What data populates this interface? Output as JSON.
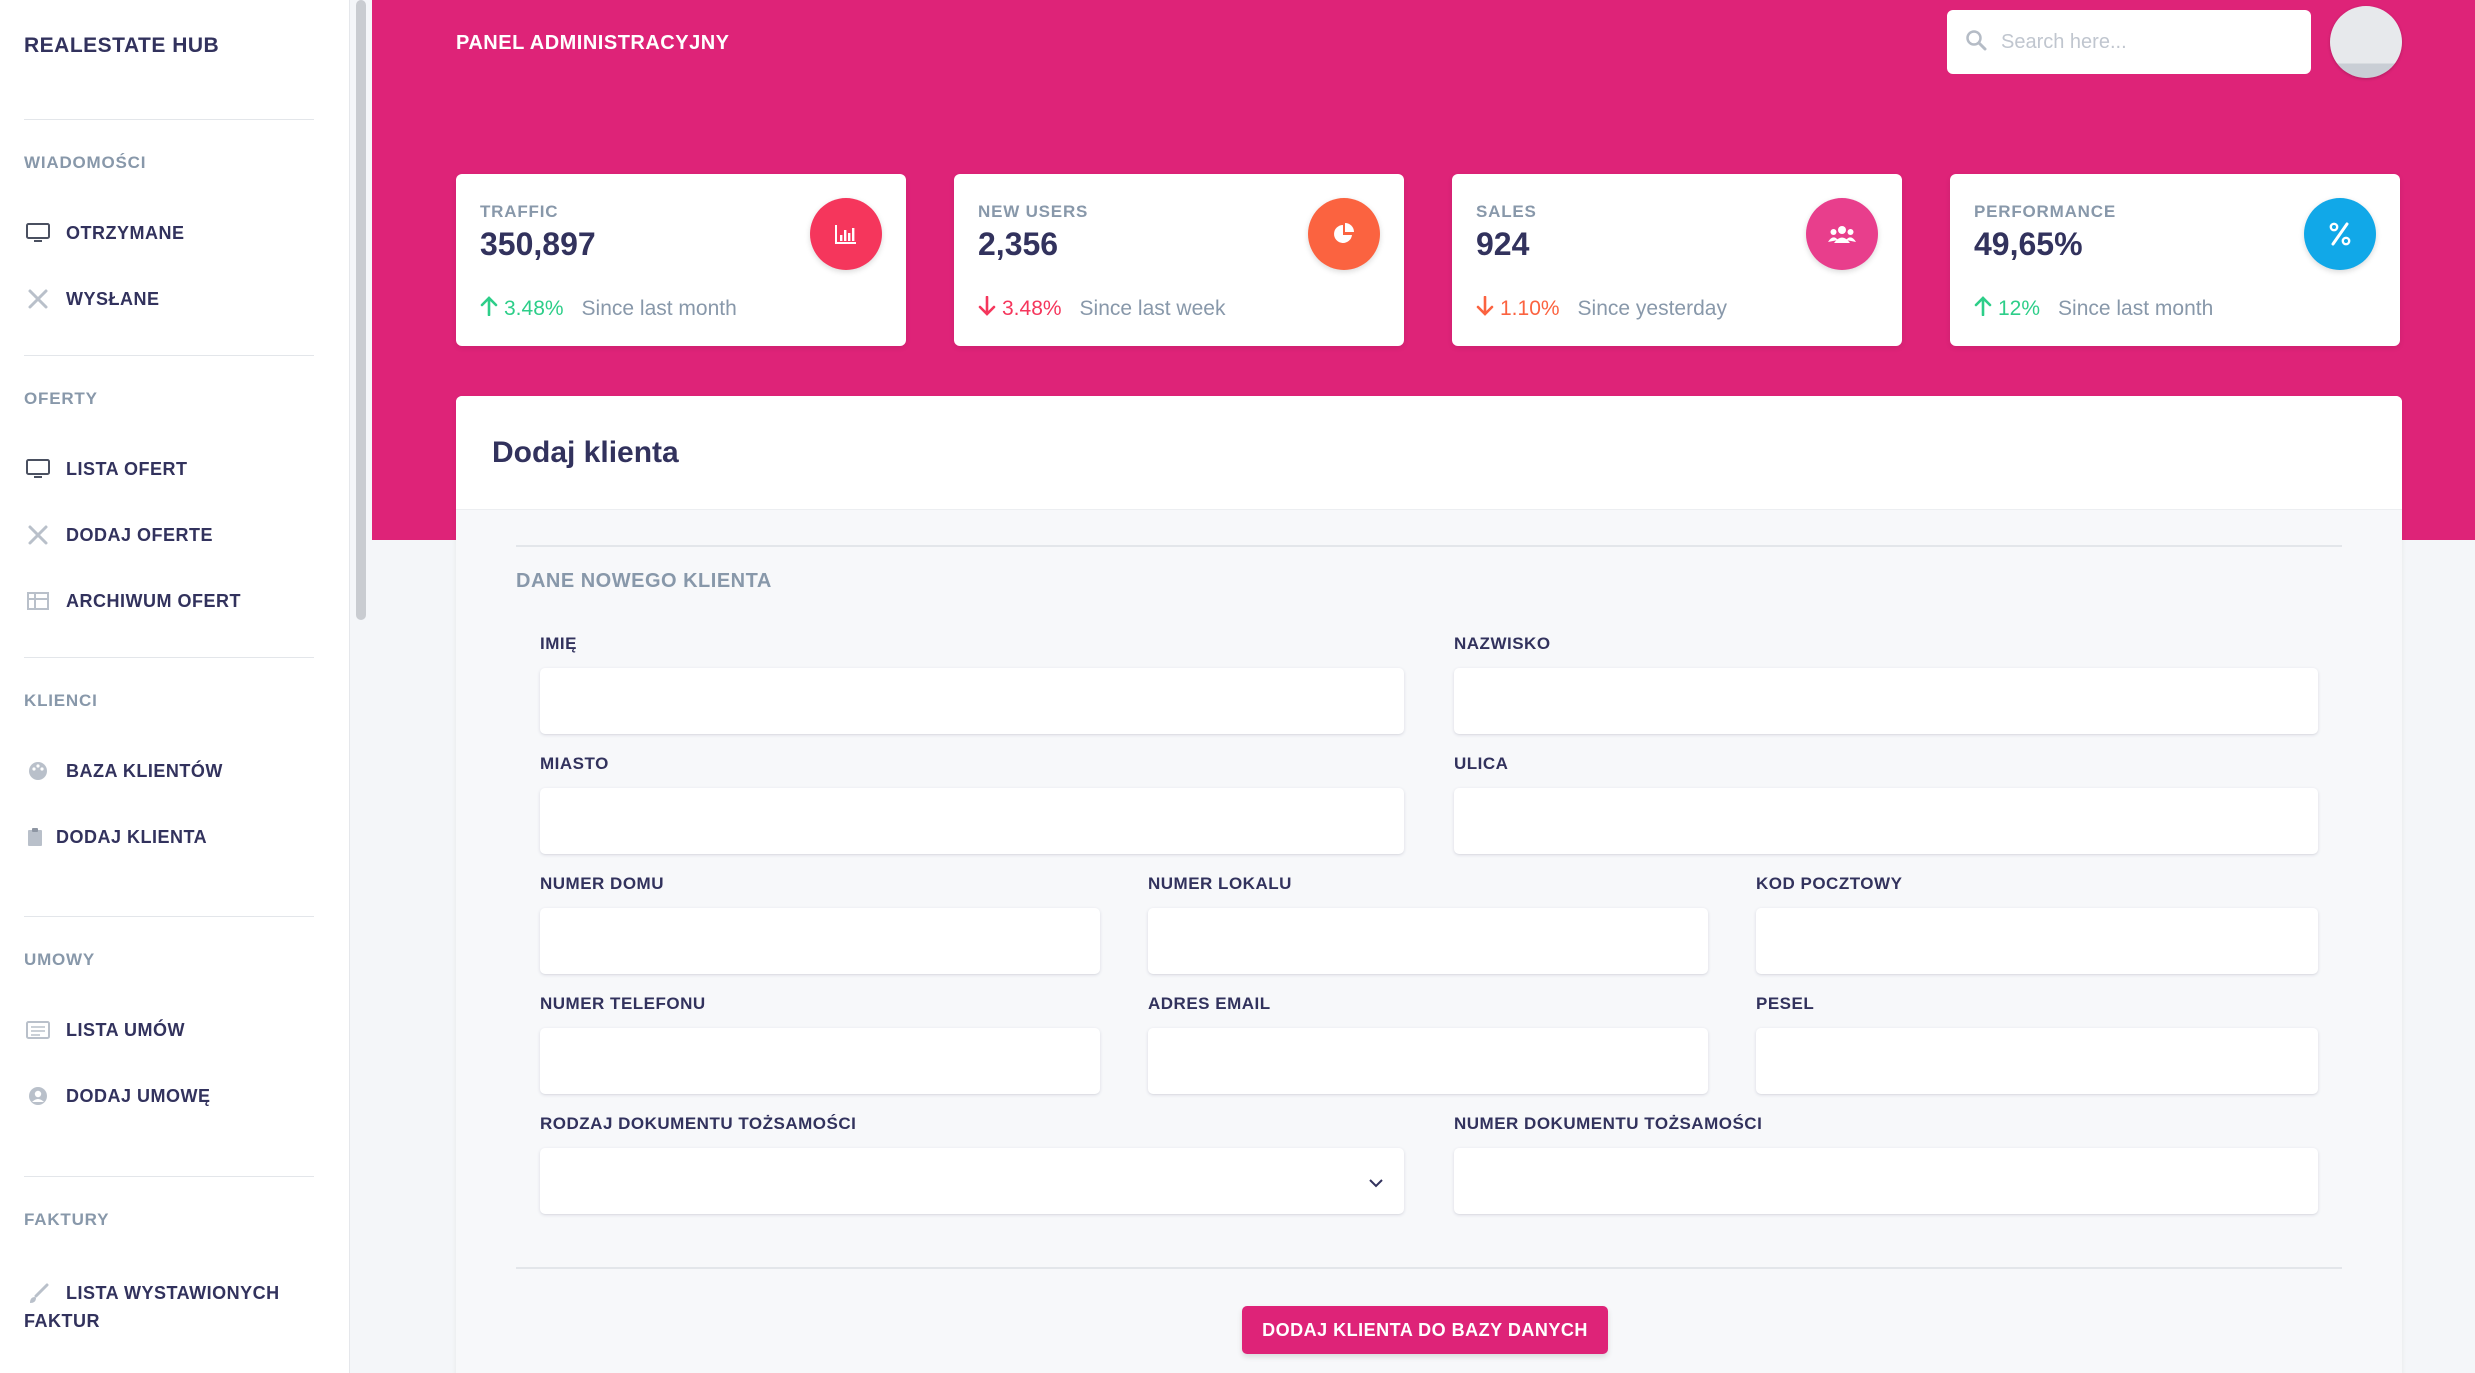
{
  "sidebar": {
    "brand": "REALESTATE HUB",
    "sections": [
      {
        "heading": "WIADOMOŚCI",
        "items": [
          {
            "label": "OTRZYMANE",
            "icon": "monitor-icon"
          },
          {
            "label": "WYSŁANE",
            "icon": "tools-icon"
          }
        ]
      },
      {
        "heading": "OFERTY",
        "items": [
          {
            "label": "LISTA OFERT",
            "icon": "monitor-icon"
          },
          {
            "label": "DODAJ OFERTE",
            "icon": "tools-icon"
          },
          {
            "label": "ARCHIWUM OFERT",
            "icon": "table-icon"
          }
        ]
      },
      {
        "heading": "KLIENCI",
        "items": [
          {
            "label": "BAZA KLIENTÓW",
            "icon": "palette-icon"
          },
          {
            "label": "DODAJ KLIENTA",
            "icon": "clipboard-icon"
          }
        ]
      },
      {
        "heading": "UMOWY",
        "items": [
          {
            "label": "LISTA UMÓW",
            "icon": "list-icon"
          },
          {
            "label": "DODAJ UMOWĘ",
            "icon": "user-circle-icon"
          }
        ]
      },
      {
        "heading": "FAKTURY",
        "items": [
          {
            "label": "LISTA WYSTAWIONYCH FAKTUR",
            "icon": "brush-icon"
          }
        ]
      }
    ]
  },
  "header": {
    "title": "PANEL ADMINISTRACYJNY",
    "search_placeholder": "Search here...",
    "accent_color": "#de2378"
  },
  "stats": [
    {
      "label": "TRAFFIC",
      "value": "350,897",
      "change": "3.48%",
      "direction": "up",
      "since": "Since last month",
      "icon": "bar-chart-icon",
      "color": "#f5365c"
    },
    {
      "label": "NEW USERS",
      "value": "2,356",
      "change": "3.48%",
      "direction": "down",
      "since": "Since last week",
      "icon": "pie-chart-icon",
      "color": "#fb6340"
    },
    {
      "label": "SALES",
      "value": "924",
      "change": "1.10%",
      "direction": "down",
      "since": "Since yesterday",
      "icon": "users-icon",
      "color": "#e83e8c"
    },
    {
      "label": "PERFORMANCE",
      "value": "49,65%",
      "change": "12%",
      "direction": "up",
      "since": "Since last month",
      "icon": "percent-icon",
      "color": "#11a8e8"
    }
  ],
  "form": {
    "title": "Dodaj klienta",
    "section": "DANE NOWEGO KLIENTA",
    "fields": {
      "imie": "IMIĘ",
      "nazwisko": "NAZWISKO",
      "miasto": "MIASTO",
      "ulica": "ULICA",
      "numer_domu": "NUMER DOMU",
      "numer_lokalu": "NUMER LOKALU",
      "kod_pocztowy": "KOD POCZTOWY",
      "numer_telefonu": "NUMER TELEFONU",
      "adres_email": "ADRES EMAIL",
      "pesel": "PESEL",
      "rodzaj_dokumentu": "RODZAJ DOKUMENTU TOŻSAMOŚCI",
      "numer_dokumentu": "NUMER DOKUMENTU TOŻSAMOŚCI"
    },
    "submit_label": "DODAJ KLIENTA DO BAZY DANYCH"
  }
}
